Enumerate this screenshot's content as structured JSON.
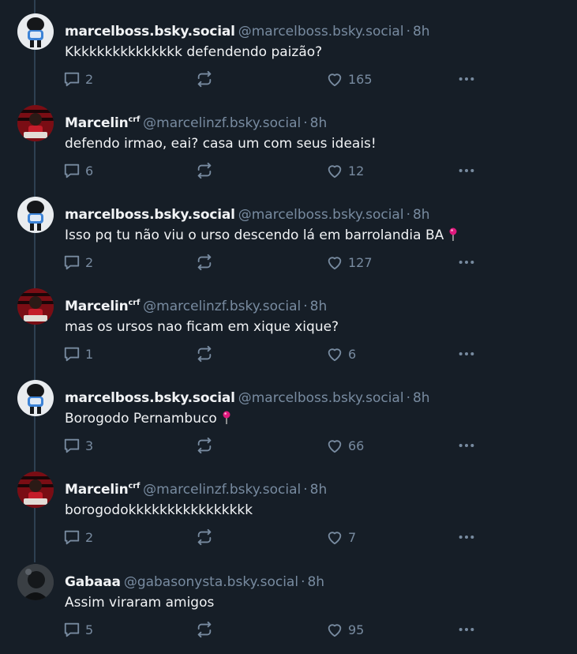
{
  "posts": [
    {
      "author_name": "marcelboss.bsky.social",
      "author_sup": "",
      "author_handle": "@marcelboss.bsky.social",
      "separator": "·",
      "time": "8h",
      "text": "Kkkkkkkkkkkkkkk defendendo paizão?",
      "pin": false,
      "avatar": "marcelboss-avatar",
      "replies": "2",
      "reposts": "",
      "likes": "165"
    },
    {
      "author_name": "Marcelin",
      "author_sup": "crf",
      "author_handle": "@marcelinzf.bsky.social",
      "separator": "·",
      "time": "8h",
      "text": "defendo irmao, eai? casa um com seus ideais!",
      "pin": false,
      "avatar": "marcelin-avatar",
      "replies": "6",
      "reposts": "",
      "likes": "12"
    },
    {
      "author_name": "marcelboss.bsky.social",
      "author_sup": "",
      "author_handle": "@marcelboss.bsky.social",
      "separator": "·",
      "time": "8h",
      "text": "Isso pq tu não viu o urso descendo lá em barrolandia BA",
      "pin": true,
      "avatar": "marcelboss-avatar",
      "replies": "2",
      "reposts": "",
      "likes": "127"
    },
    {
      "author_name": "Marcelin",
      "author_sup": "crf",
      "author_handle": "@marcelinzf.bsky.social",
      "separator": "·",
      "time": "8h",
      "text": "mas os ursos nao ficam em xique xique?",
      "pin": false,
      "avatar": "marcelin-avatar",
      "replies": "1",
      "reposts": "",
      "likes": "6"
    },
    {
      "author_name": "marcelboss.bsky.social",
      "author_sup": "",
      "author_handle": "@marcelboss.bsky.social",
      "separator": "·",
      "time": "8h",
      "text": "Borogodo Pernambuco",
      "pin": true,
      "avatar": "marcelboss-avatar",
      "replies": "3",
      "reposts": "",
      "likes": "66"
    },
    {
      "author_name": "Marcelin",
      "author_sup": "crf",
      "author_handle": "@marcelinzf.bsky.social",
      "separator": "·",
      "time": "8h",
      "text": "borogodokkkkkkkkkkkkkkkk",
      "pin": false,
      "avatar": "marcelin-avatar",
      "replies": "2",
      "reposts": "",
      "likes": "7"
    },
    {
      "author_name": "Gabaaa",
      "author_sup": "",
      "author_handle": "@gabasonysta.bsky.social",
      "separator": "·",
      "time": "8h",
      "text": "Assim viraram amigos",
      "pin": false,
      "avatar": "gabaaa-avatar",
      "replies": "5",
      "reposts": "",
      "likes": "95"
    }
  ],
  "colors": {
    "background": "#161e27",
    "text": "#f1f3f5",
    "muted": "#788ba0",
    "thread_line": "#2e4052",
    "pin": "#e0197d"
  }
}
